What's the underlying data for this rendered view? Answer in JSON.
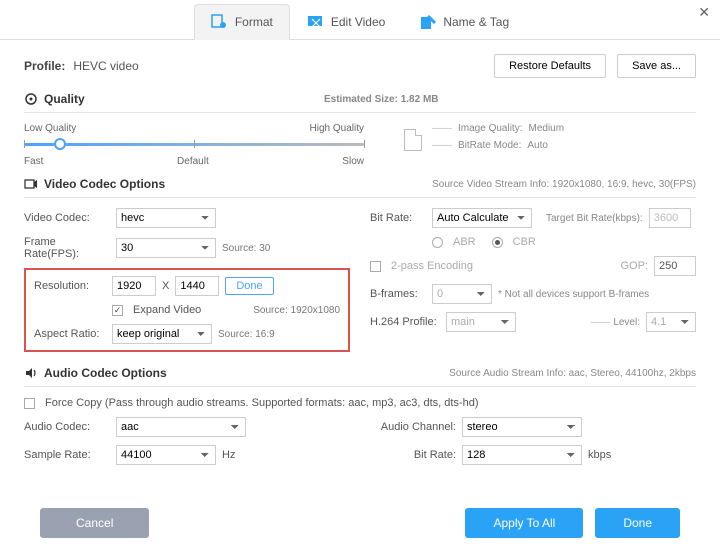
{
  "window": {
    "close_icon": "close"
  },
  "tabs": {
    "format": "Format",
    "edit_video": "Edit Video",
    "name_tag": "Name & Tag"
  },
  "profile": {
    "label": "Profile:",
    "value": "HEVC video",
    "restore": "Restore Defaults",
    "saveas": "Save as..."
  },
  "quality": {
    "title": "Quality",
    "est_label": "Estimated Size:",
    "est_value": "1.82 MB",
    "low": "Low Quality",
    "high": "High Quality",
    "fast": "Fast",
    "default": "Default",
    "slow": "Slow",
    "img_quality_label": "Image Quality:",
    "img_quality_value": "Medium",
    "bitrate_mode_label": "BitRate Mode:",
    "bitrate_mode_value": "Auto"
  },
  "video": {
    "title": "Video Codec Options",
    "stream_info": "Source Video Stream Info: 1920x1080, 16:9, hevc, 30(FPS)",
    "codec_label": "Video Codec:",
    "codec_value": "hevc",
    "fps_label": "Frame Rate(FPS):",
    "fps_value": "30",
    "fps_source": "Source: 30",
    "res_label": "Resolution:",
    "res_w": "1920",
    "res_x": "X",
    "res_h": "1440",
    "done": "Done",
    "expand": "Expand Video",
    "res_source": "Source: 1920x1080",
    "ar_label": "Aspect Ratio:",
    "ar_value": "keep original",
    "ar_source": "Source: 16:9",
    "bitrate_label": "Bit Rate:",
    "bitrate_value": "Auto Calculate",
    "target_label": "Target Bit Rate(kbps):",
    "target_value": "3600",
    "abr": "ABR",
    "cbr": "CBR",
    "twopass": "2-pass Encoding",
    "gop_label": "GOP:",
    "gop_value": "250",
    "bframes_label": "B-frames:",
    "bframes_value": "0",
    "bframes_note": "* Not all devices support B-frames",
    "h264_label": "H.264 Profile:",
    "h264_value": "main",
    "level_label": "Level:",
    "level_value": "4.1"
  },
  "audio": {
    "title": "Audio Codec Options",
    "stream_info": "Source Audio Stream Info: aac, Stereo, 44100hz, 2kbps",
    "force_copy": "Force Copy (Pass through audio streams. Supported formats: aac, mp3, ac3, dts, dts-hd)",
    "codec_label": "Audio Codec:",
    "codec_value": "aac",
    "sample_label": "Sample Rate:",
    "sample_value": "44100",
    "hz": "Hz",
    "channel_label": "Audio Channel:",
    "channel_value": "stereo",
    "bitrate_label": "Bit Rate:",
    "bitrate_value": "128",
    "kbps": "kbps"
  },
  "footer": {
    "cancel": "Cancel",
    "apply_all": "Apply To All",
    "done": "Done"
  }
}
